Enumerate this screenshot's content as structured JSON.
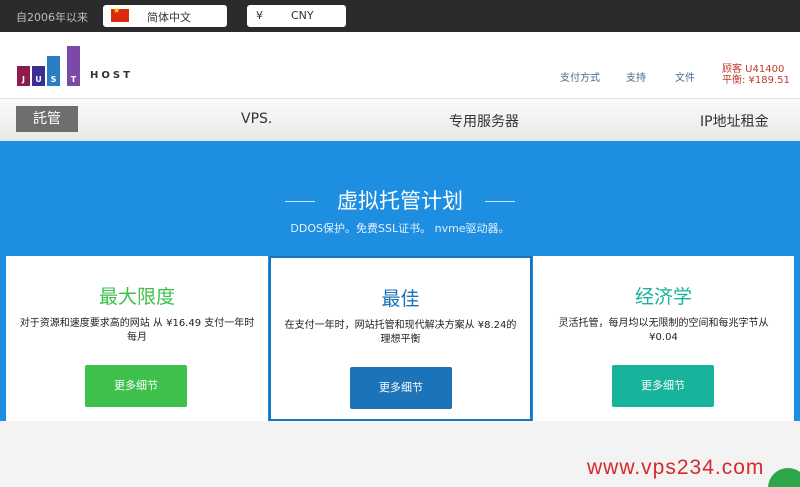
{
  "topbar": {
    "since": "自2006年以来",
    "language": "简体中文",
    "currency_symbol": "¥",
    "currency": "CNY"
  },
  "header": {
    "logo_letters": [
      "J",
      "U",
      "S",
      "T"
    ],
    "logo_host": "HOST",
    "links": [
      "支付方式",
      "支持",
      "文件"
    ],
    "account_label": "顾客 U41400",
    "balance_label": "平衡: ¥189.51"
  },
  "nav": {
    "items": [
      "託管",
      "VPS.",
      "专用服务器",
      "IP地址租金"
    ]
  },
  "hero": {
    "title": "虚拟托管计划",
    "subtitle": "DDOS保护。免费SSL证书。 nvme驱动器。"
  },
  "plans": [
    {
      "title": "最大限度",
      "desc_line1": "对于资源和速度要求高的网站 从 ¥16.49 支付一年时",
      "desc_line2": "每月",
      "button": "更多细节",
      "color": "#3ec04c"
    },
    {
      "title": "最佳",
      "desc_line1": "在支付一年时，网站托管和现代解决方案从 ¥8.24的",
      "desc_line2": "理想平衡",
      "button": "更多细节",
      "color": "#1d73b8"
    },
    {
      "title": "经济学",
      "desc_line1": "灵活托管，每月均以无限制的空间和每兆字节从",
      "desc_line2": "¥0.04",
      "button": "更多细节",
      "color": "#17b39b"
    }
  ],
  "watermark": "www.vps234.com",
  "colors": {
    "hero": "#1d8ee0",
    "topbar": "#2b2b2b",
    "plan_max": "#3ec04c",
    "plan_best": "#1d73b8",
    "plan_econ": "#17b39b"
  }
}
